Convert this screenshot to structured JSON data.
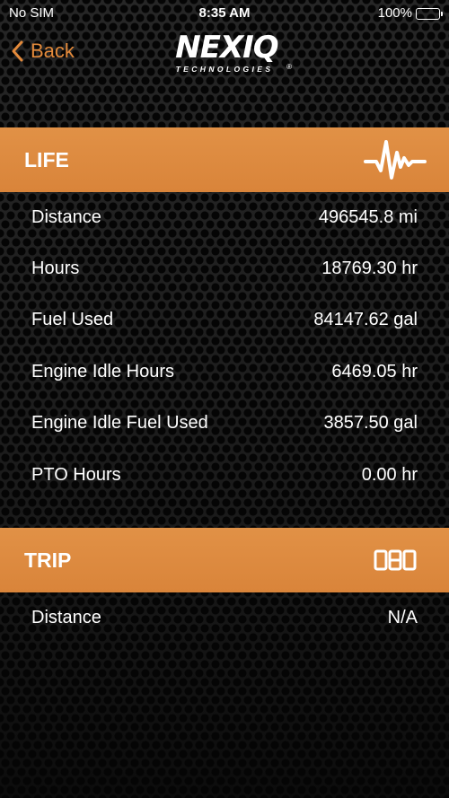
{
  "status_bar": {
    "carrier": "No SIM",
    "time": "8:35 AM",
    "battery": "100%"
  },
  "nav": {
    "back_label": "Back",
    "logo_text": "NEXIQ",
    "logo_subtext": "TECHNOLOGIES",
    "logo_mark": "®"
  },
  "life": {
    "title": "LIFE",
    "icon": "waveform-icon",
    "rows": [
      {
        "label": "Distance",
        "value": "496545.8 mi"
      },
      {
        "label": "Hours",
        "value": "18769.30 hr"
      },
      {
        "label": "Fuel Used",
        "value": "84147.62 gal"
      },
      {
        "label": "Engine Idle Hours",
        "value": "6469.05 hr"
      },
      {
        "label": "Engine Idle Fuel Used",
        "value": "3857.50 gal"
      },
      {
        "label": "PTO Hours",
        "value": "0.00 hr"
      }
    ]
  },
  "trip": {
    "title": "TRIP",
    "icon": "odometer-icon",
    "rows": [
      {
        "label": "Distance",
        "value": "N/A"
      }
    ]
  },
  "colors": {
    "accent": "#e38a3b",
    "header_bg": "#dc8a40",
    "text": "#ffffff"
  }
}
